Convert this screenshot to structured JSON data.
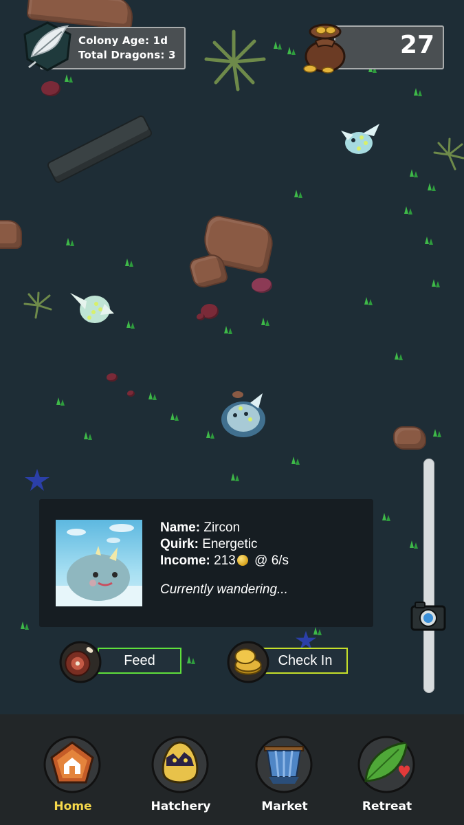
{
  "hud": {
    "colony_age_line": "Colony Age: 1d",
    "total_dragons_line": "Total Dragons: 3",
    "coins": "27"
  },
  "dragon_info": {
    "name_label": "Name:",
    "name_value": "Zircon",
    "quirk_label": "Quirk:",
    "quirk_value": "Energetic",
    "income_label": "Income:",
    "income_amount": "213",
    "income_rate": "@ 6/s",
    "status": "Currently wandering..."
  },
  "actions": {
    "feed_label": "Feed",
    "checkin_label": "Check In"
  },
  "nav": {
    "items": [
      {
        "label": "Home",
        "icon": "home-icon",
        "active": true
      },
      {
        "label": "Hatchery",
        "icon": "egg-icon",
        "active": false
      },
      {
        "label": "Market",
        "icon": "market-stall-icon",
        "active": false
      },
      {
        "label": "Retreat",
        "icon": "leaf-heart-icon",
        "active": false
      }
    ]
  },
  "colors": {
    "background": "#1e2d36",
    "panel": "#4a4f52",
    "feed_border": "#5fe03c",
    "checkin_border": "#c6e02a",
    "active_nav": "#f6d84b",
    "nav_bar": "#222628"
  }
}
